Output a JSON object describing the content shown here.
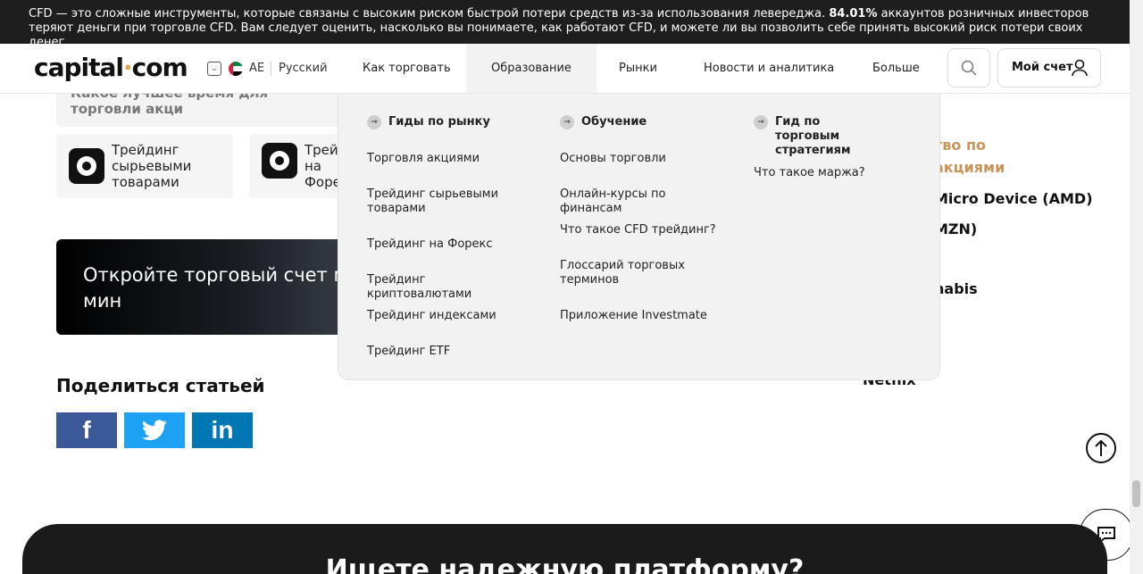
{
  "risk_banner": {
    "text_before": "CFD — это сложные инструменты, которые связаны с высоким риском быстрой потери средств из-за использования левереджа. ",
    "percent": "84.01%",
    "text_after": " аккаунтов розничных инвесторов теряют деньги при торговле CFD. Вам следует оценить, насколько вы понимаете, как работают CFD, и можете ли вы позволить себе принять высокий риск потери своих денег."
  },
  "header": {
    "logo_left": "capital",
    "logo_dot": "·",
    "logo_right": "com",
    "region": "AE",
    "language": "Русский",
    "nav": [
      "Как торговать",
      "Образование",
      "Рынки",
      "Новости и аналитика",
      "Больше"
    ],
    "account_label": "Мой счет"
  },
  "mega_menu": {
    "columns": [
      {
        "title": "Гиды по рынку",
        "items": [
          "Торговля акциями",
          "Трейдинг сырьевыми товарами",
          "Трейдинг на Форекс",
          "Трейдинг криптовалютами",
          "Трейдинг индексами",
          "Трейдинг ETF"
        ]
      },
      {
        "title": "Обучение",
        "items": [
          "Основы торговли",
          "Онлайн-курсы по финансам",
          "Что такое CFD трейдинг?",
          "Глоссарий торговых терминов",
          "Приложение Investmate"
        ]
      },
      {
        "title": "Гид по торговым стратегиям",
        "items": [
          "Что такое маржа?"
        ]
      }
    ]
  },
  "page": {
    "prev_card_text": "Какое лучшее время для торговли акци",
    "tiles": [
      "Трейдинг сырьевыми товарами",
      "Трейдинг на Форе"
    ],
    "cta_text": "Откройте торговый счет ме мин",
    "share_title": "Поделиться статьей",
    "social": [
      "f",
      "t",
      "in"
    ],
    "sidebar_title": "тво по акциями",
    "sidebar_links": [
      "Micro Device (AMD)",
      "MZN)",
      "nabis",
      "Netflix"
    ],
    "footer_heading": "Ищете надежную платформу?"
  },
  "colors": {
    "banner_bg": "#1e1e1e",
    "accent": "#e6a24a",
    "facebook": "#3b5998",
    "twitter": "#1da1f2",
    "linkedin": "#0077b5"
  }
}
